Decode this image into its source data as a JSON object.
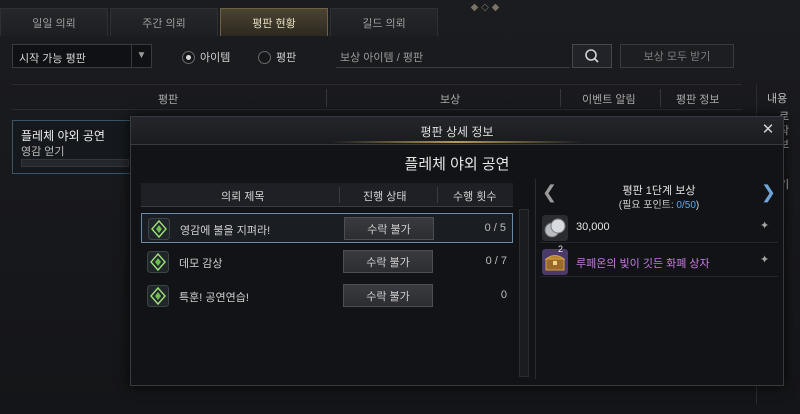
{
  "tabs": [
    "일일 의뢰",
    "주간 의뢰",
    "평판 현황",
    "길드 의뢰"
  ],
  "active_tab": 2,
  "filter": {
    "select_value": "시작 가능 평판",
    "radio_item": "아이템",
    "radio_rep": "평판",
    "search_placeholder": "보상 아이템 / 평판",
    "reward_all": "보상 모두 받기"
  },
  "table_header": {
    "col_rep": "평판",
    "col_reward": "보상",
    "col_event": "이벤트 알림",
    "col_info": "평판 정보"
  },
  "right_panel": {
    "title": "내용",
    "lines": [
      "로",
      "작",
      "보"
    ],
    "tail": "기"
  },
  "bg_item": {
    "name": "플레체 야외 공연",
    "sub": "영감 얻기"
  },
  "dialog": {
    "title": "평판 상세 정보",
    "subtitle": "플레체 야외 공연",
    "quest_headers": {
      "title": "의뢰 제목",
      "status": "진행 상태",
      "count": "수행 횟수"
    },
    "quests": [
      {
        "title": "영감에 불을 지펴라!",
        "status": "수락 불가",
        "count": "0 / 5"
      },
      {
        "title": "데모 감상",
        "status": "수락 불가",
        "count": "0 / 7"
      },
      {
        "title": "특훈! 공연연습!",
        "status": "수락 불가",
        "count": "0"
      }
    ],
    "rewards": {
      "title": "평판 1단계 보상",
      "points_label": "(필요 포인트: ",
      "points_value": "0/50",
      "points_close": ")",
      "items": [
        {
          "name": "30,000",
          "color": "#e6e6e6",
          "icon": "silver-coins-icon"
        },
        {
          "name": "루페온의 빛이 깃든 화폐 상자",
          "color": "#c57be0",
          "icon": "treasure-chest-icon",
          "qty": "2"
        }
      ]
    }
  },
  "colors": {
    "accent_gold": "#b49a5a",
    "selected_border": "#6b8aa6",
    "points_blue": "#5fa8e8",
    "epic_purple": "#c57be0"
  }
}
